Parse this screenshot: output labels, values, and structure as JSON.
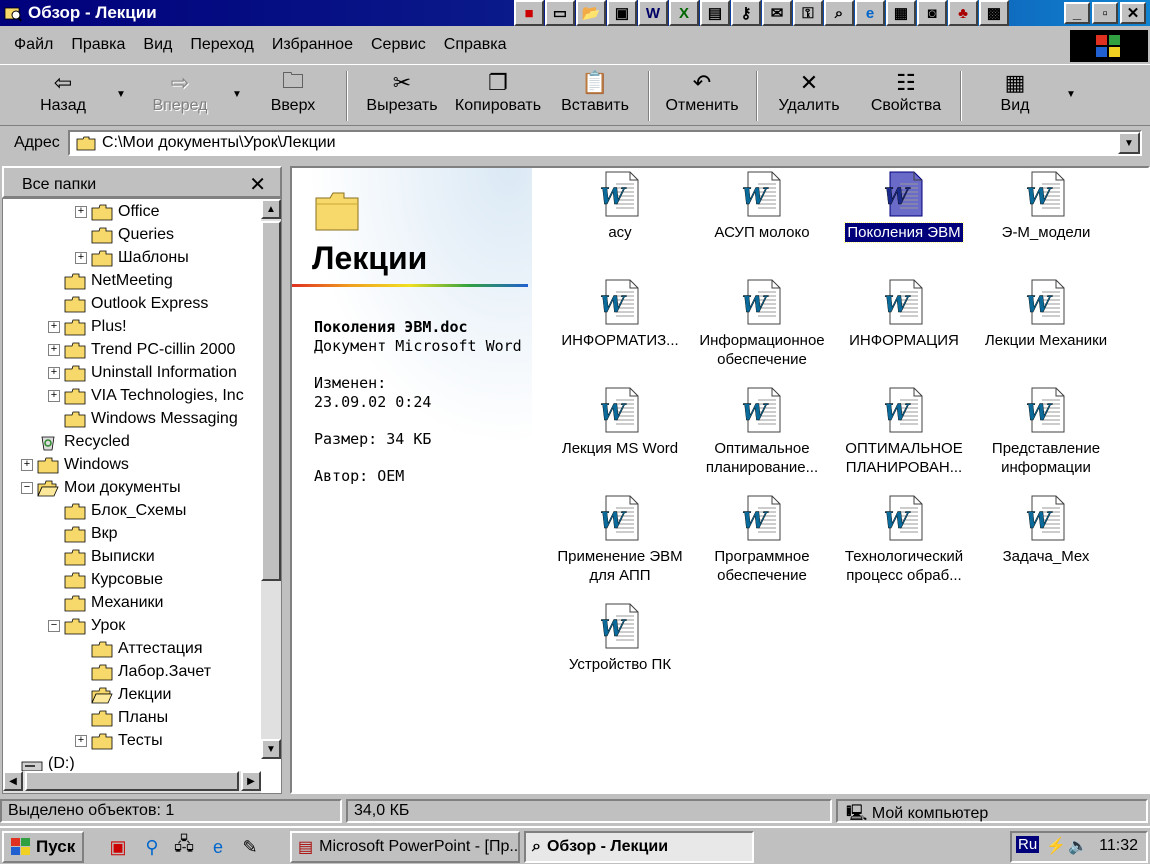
{
  "window": {
    "title": "Обзор - Лекции"
  },
  "menu": [
    "Файл",
    "Правка",
    "Вид",
    "Переход",
    "Избранное",
    "Сервис",
    "Справка"
  ],
  "toolbar": {
    "back": "Назад",
    "forward": "Вперед",
    "up": "Вверх",
    "cut": "Вырезать",
    "copy": "Копировать",
    "paste": "Вставить",
    "undo": "Отменить",
    "delete": "Удалить",
    "properties": "Свойства",
    "view": "Вид"
  },
  "address": {
    "label": "Адрес",
    "value": "C:\\Мои документы\\Урок\\Лекции"
  },
  "tree": {
    "header": "Все папки",
    "items": [
      {
        "label": "Office",
        "level": 3,
        "expander": "+"
      },
      {
        "label": "Queries",
        "level": 3,
        "expander": ""
      },
      {
        "label": "Шаблоны",
        "level": 3,
        "expander": "+"
      },
      {
        "label": "NetMeeting",
        "level": 2,
        "expander": ""
      },
      {
        "label": "Outlook Express",
        "level": 2,
        "expander": ""
      },
      {
        "label": "Plus!",
        "level": 2,
        "expander": "+"
      },
      {
        "label": "Trend PC-cillin 2000",
        "level": 2,
        "expander": "+"
      },
      {
        "label": "Uninstall Information",
        "level": 2,
        "expander": "+"
      },
      {
        "label": "VIA Technologies, Inc",
        "level": 2,
        "expander": "+"
      },
      {
        "label": "Windows Messaging",
        "level": 2,
        "expander": ""
      },
      {
        "label": "Recycled",
        "level": 1,
        "expander": "",
        "icon": "recycle"
      },
      {
        "label": "Windows",
        "level": 1,
        "expander": "+"
      },
      {
        "label": "Мои документы",
        "level": 1,
        "expander": "-",
        "icon": "open"
      },
      {
        "label": "Блок_Схемы",
        "level": 2,
        "expander": ""
      },
      {
        "label": "Вкр",
        "level": 2,
        "expander": ""
      },
      {
        "label": "Выписки",
        "level": 2,
        "expander": ""
      },
      {
        "label": "Курсовые",
        "level": 2,
        "expander": ""
      },
      {
        "label": "Механики",
        "level": 2,
        "expander": ""
      },
      {
        "label": "Урок",
        "level": 2,
        "expander": "-"
      },
      {
        "label": "Аттестация",
        "level": 3,
        "expander": ""
      },
      {
        "label": "Лабор.Зачет",
        "level": 3,
        "expander": ""
      },
      {
        "label": "Лекции",
        "level": 3,
        "expander": "",
        "icon": "open"
      },
      {
        "label": "Планы",
        "level": 3,
        "expander": ""
      },
      {
        "label": "Тесты",
        "level": 3,
        "expander": "+"
      },
      {
        "label": "(D:)",
        "level": 0,
        "expander": "",
        "icon": "drive"
      }
    ]
  },
  "folder_view": {
    "title": "Лекции",
    "selected_name": "Поколения ЭВМ.doc",
    "selected_type": "Документ Microsoft Word",
    "modified_label": "Изменен:",
    "modified_value": "23.09.02 0:24",
    "size": "Размер: 34 КБ",
    "author": "Автор: OEM"
  },
  "files": [
    {
      "name": "асу"
    },
    {
      "name": "АСУП молоко"
    },
    {
      "name": "Поколения ЭВМ",
      "selected": true
    },
    {
      "name": "Э-М_модели"
    },
    {
      "name": "ИНФОРМАТИЗ..."
    },
    {
      "name": "Информационное обеспечение"
    },
    {
      "name": "ИНФОРМАЦИЯ"
    },
    {
      "name": "Лекции Механики"
    },
    {
      "name": "Лекция MS Word"
    },
    {
      "name": "Оптимальное планирование..."
    },
    {
      "name": "ОПТИМАЛЬНОЕ ПЛАНИРОВАН..."
    },
    {
      "name": "Представление информации"
    },
    {
      "name": "Применение ЭВМ для АПП"
    },
    {
      "name": "Программное обеспечение"
    },
    {
      "name": "Технологический процесс обраб..."
    },
    {
      "name": "Задача_Мех"
    },
    {
      "name": "Устройство ПК"
    }
  ],
  "status": {
    "selected": "Выделено объектов: 1",
    "size": "34,0 КБ",
    "location": "Мой компьютер"
  },
  "taskbar": {
    "start": "Пуск",
    "tasks": [
      "Microsoft PowerPoint - [Пр...",
      "Обзор - Лекции"
    ],
    "lang": "Ru",
    "time": "11:32"
  },
  "colors": {
    "title_bar": "#00007b",
    "selection": "#00007b",
    "folder": "#f7d96b"
  }
}
